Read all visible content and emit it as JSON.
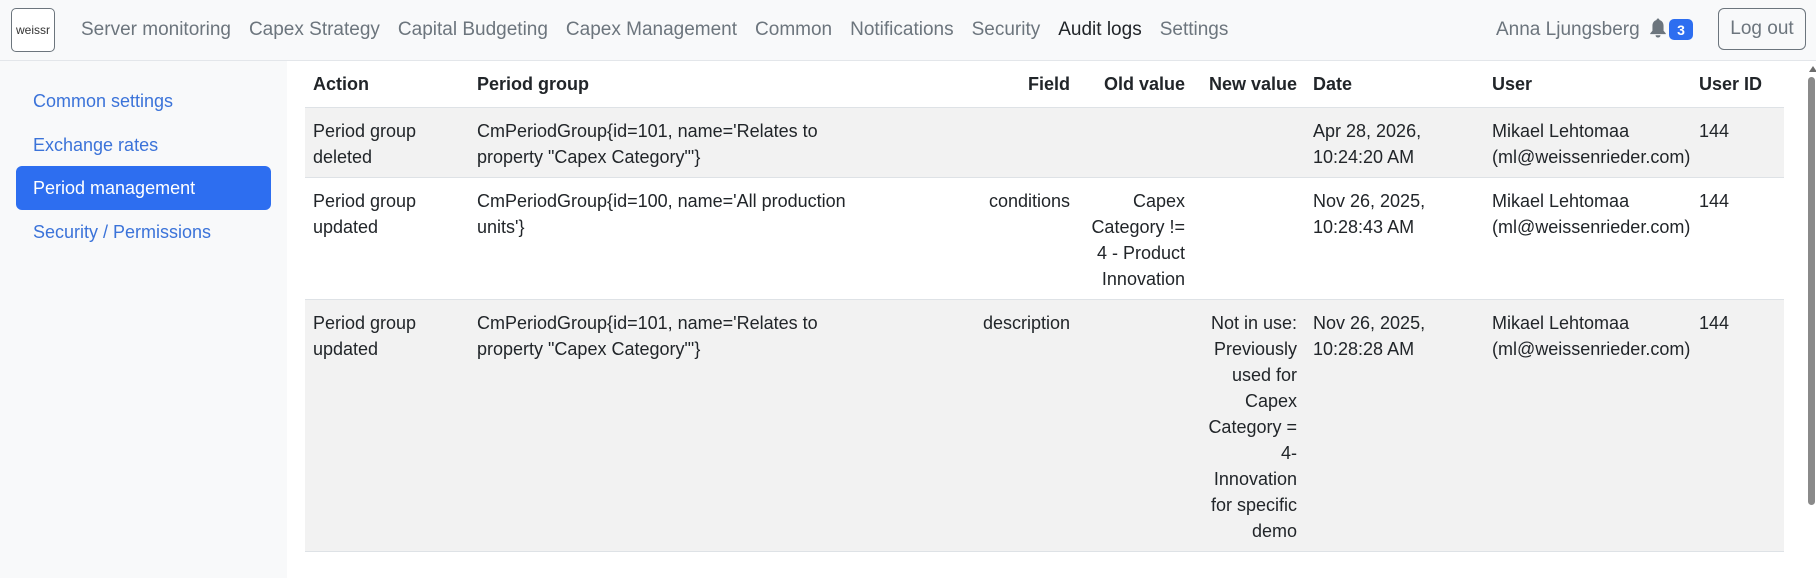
{
  "navbar": {
    "logo_text": "weissr",
    "links": [
      {
        "label": "Server monitoring",
        "active": false
      },
      {
        "label": "Capex Strategy",
        "active": false
      },
      {
        "label": "Capital Budgeting",
        "active": false
      },
      {
        "label": "Capex Management",
        "active": false
      },
      {
        "label": "Common",
        "active": false
      },
      {
        "label": "Notifications",
        "active": false
      },
      {
        "label": "Security",
        "active": false
      },
      {
        "label": "Audit logs",
        "active": true
      },
      {
        "label": "Settings",
        "active": false
      }
    ],
    "user_name": "Anna Ljungsberg",
    "notification_count": "3",
    "logout_label": "Log out"
  },
  "sidebar": {
    "items": [
      {
        "label": "Common settings",
        "active": false
      },
      {
        "label": "Exchange rates",
        "active": false
      },
      {
        "label": "Period management",
        "active": true
      },
      {
        "label": "Security / Permissions",
        "active": false
      }
    ]
  },
  "table": {
    "headers": {
      "action": "Action",
      "period_group": "Period group",
      "field": "Field",
      "old_value": "Old value",
      "new_value": "New value",
      "date": "Date",
      "user": "User",
      "user_id": "User ID"
    },
    "rows": [
      {
        "action": "Period group deleted",
        "period_group": "CmPeriodGroup{id=101, name='Relates to property \"Capex Category\"'}",
        "field": "",
        "old_value": "",
        "new_value": "",
        "date": "Apr 28, 2026, 10:24:20 AM",
        "user": "Mikael Lehtomaa (ml@weissenrieder.com)",
        "user_id": "144"
      },
      {
        "action": "Period group updated",
        "period_group": "CmPeriodGroup{id=100, name='All production units'}",
        "field": "conditions",
        "old_value": "Capex Category != 4 - Product Innovation",
        "new_value": "",
        "date": "Nov 26, 2025, 10:28:43 AM",
        "user": "Mikael Lehtomaa (ml@weissenrieder.com)",
        "user_id": "144"
      },
      {
        "action": "Period group updated",
        "period_group": "CmPeriodGroup{id=101, name='Relates to property \"Capex Category\"'}",
        "field": "description",
        "old_value": "",
        "new_value": "Not in use: Previously used for Capex Category = 4- Innovation for specific demo",
        "date": "Nov 26, 2025, 10:28:28 AM",
        "user": "Mikael Lehtomaa (ml@weissenrieder.com)",
        "user_id": "144"
      }
    ]
  },
  "colors": {
    "accent": "#2d6ef0",
    "link": "#3b73d9",
    "muted": "#6c757d",
    "stripe": "#f2f2f2"
  }
}
